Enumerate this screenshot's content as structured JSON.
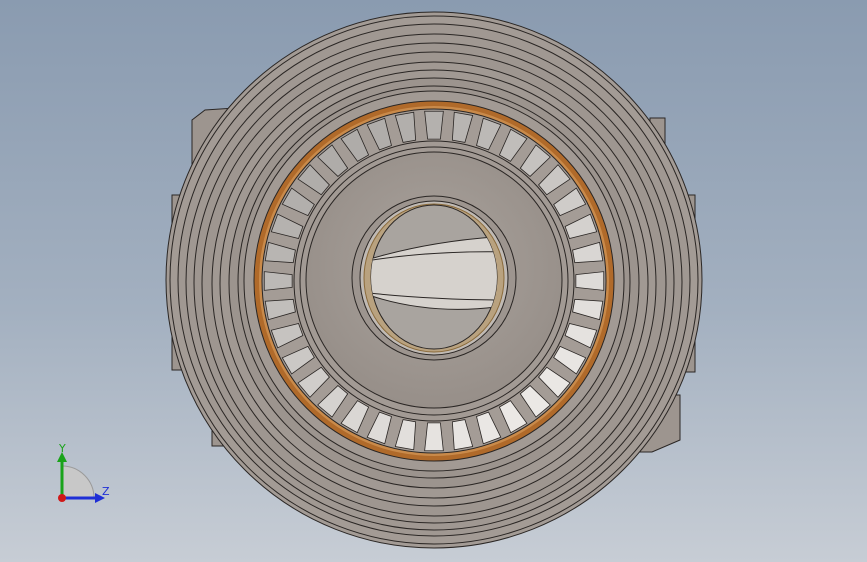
{
  "viewport": {
    "background_top": "#8a9bb0",
    "background_bottom": "#c7cdd5"
  },
  "model": {
    "part_color": "#a09892",
    "edge_color": "#2a2624",
    "cage_color": "#b06a2a",
    "shaded_face_color": "#cfcac5"
  },
  "triad": {
    "y_label": "Y",
    "z_label": "Z",
    "y_color": "#1aa31a",
    "z_color": "#1f2fd6",
    "origin_color": "#d01818"
  }
}
